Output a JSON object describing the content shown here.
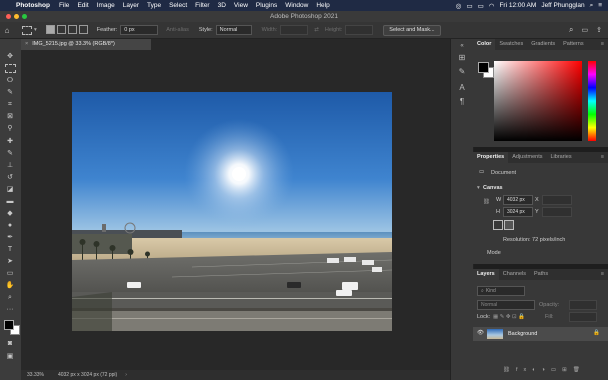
{
  "menubar": {
    "app_name": "Photoshop",
    "items": [
      "File",
      "Edit",
      "Image",
      "Layer",
      "Type",
      "Select",
      "Filter",
      "3D",
      "View",
      "Plugins",
      "Window",
      "Help"
    ],
    "clock": "Fri 12:00 AM",
    "user": "Jeff Phungglan"
  },
  "window": {
    "title": "Adobe Photoshop 2021"
  },
  "options": {
    "feather_label": "Feather:",
    "feather_value": "0 px",
    "antialias_label": "Anti-alias",
    "style_label": "Style:",
    "style_value": "Normal",
    "width_label": "Width:",
    "height_label": "Height:",
    "select_mask_button": "Select and Mask..."
  },
  "document": {
    "tab_label": "IMG_5215.jpg @ 33.3% (RGB/8*)"
  },
  "status": {
    "zoom": "33.33%",
    "info": "4032 px x 3024 px (72 ppi)"
  },
  "color_panel": {
    "tabs": [
      "Color",
      "Swatches",
      "Gradients",
      "Patterns"
    ],
    "hue_color": "#ff0000"
  },
  "properties_panel": {
    "tabs": [
      "Properties",
      "Adjustments",
      "Libraries"
    ],
    "doc_type": "Document",
    "section": "Canvas",
    "w_label": "W",
    "w_value": "4032 px",
    "h_label": "H",
    "h_value": "3024 px",
    "x_label": "X",
    "y_label": "Y",
    "resolution": "Resolution: 72 pixels/inch",
    "mode_label": "Mode"
  },
  "layers_panel": {
    "tabs": [
      "Layers",
      "Channels",
      "Paths"
    ],
    "kind_label": "Kind",
    "blend_mode": "Normal",
    "opacity_label": "Opacity:",
    "lock_label": "Lock:",
    "fill_label": "Fill:",
    "layer_name": "Background"
  }
}
